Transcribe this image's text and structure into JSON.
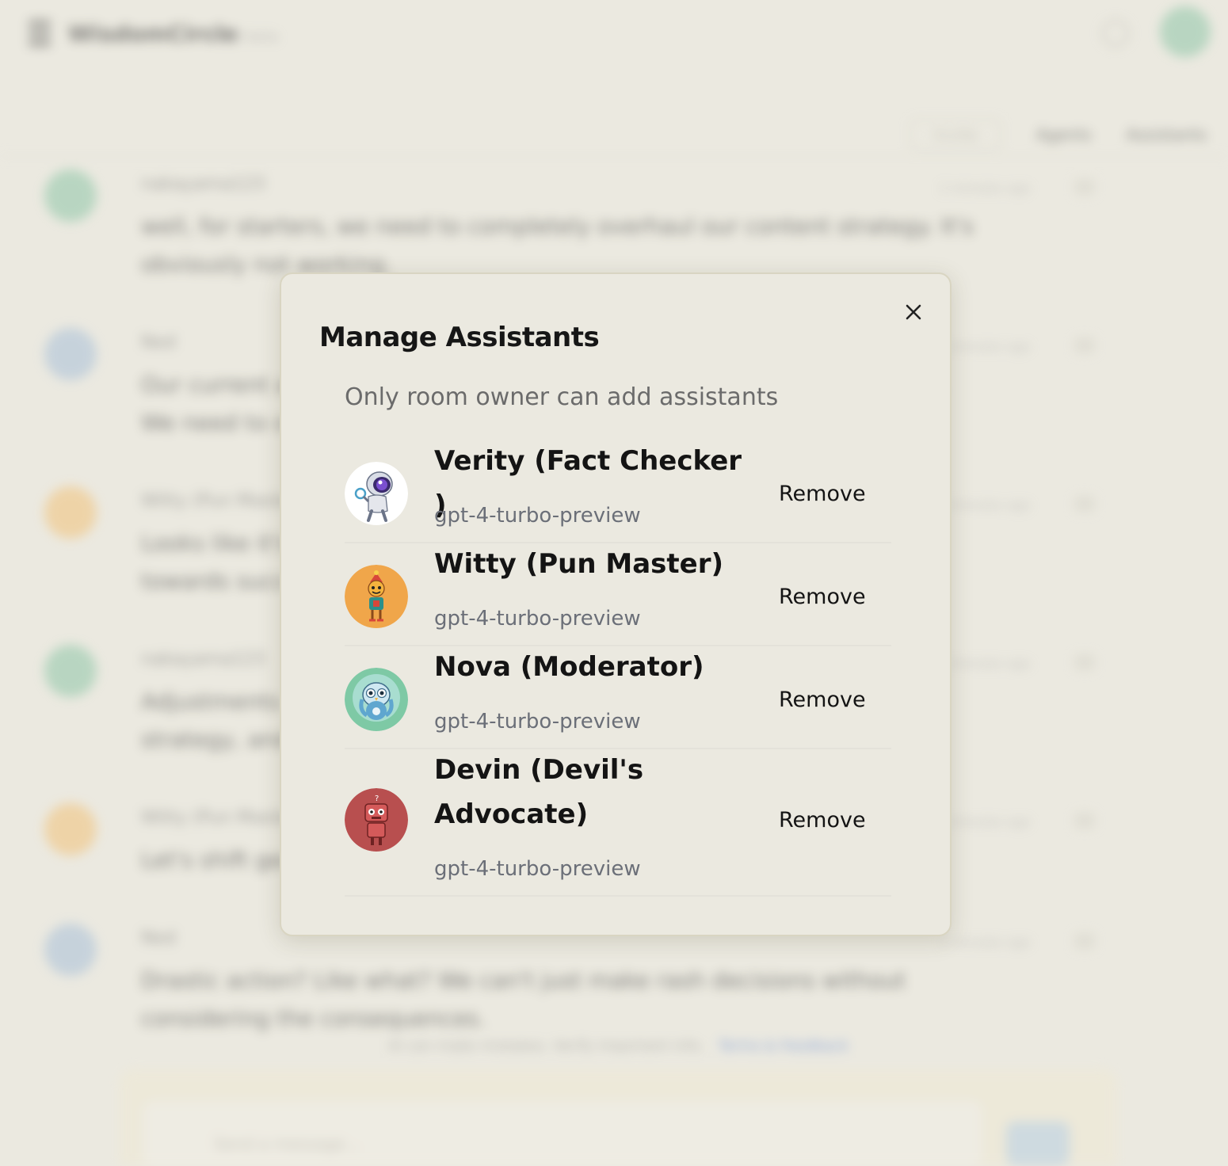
{
  "background": {
    "app_title": "WisdomCircle",
    "app_subtitle": "v1.0 beta",
    "tabs": [
      "Invite",
      "Agents",
      "Assistants"
    ],
    "messages": [
      {
        "name": "nakayama123",
        "time": "2 minutes ago",
        "text": "well, for starters, we need to completely overhaul our content strategy. It's obviously not working.",
        "avatar_color": "#8fc6a8"
      },
      {
        "name": "Ned",
        "time": "2 minutes ago",
        "text": "Our current approach doesn't seem to be getting the results we wanted. We need to overhaul to improve the outcomes.",
        "avatar_color": "#a9c0d8"
      },
      {
        "name": "Witty (Pun Master)",
        "time": "2 minutes ago",
        "text": "Looks like it's time to shake things up a bit! Let's take a creative turn towards success.",
        "avatar_color": "#f1c27a"
      },
      {
        "name": "nakayama123",
        "time": "2 minutes ago",
        "text": "Adjustments aren't going to cut it. We need a complete overhaul of our strategy, and we need to act now.",
        "avatar_color": "#8fc6a8"
      },
      {
        "name": "Witty (Pun Master)",
        "time": "2 minutes ago",
        "text": "Let's shift gears and steer toward a bold new direction!",
        "avatar_color": "#f1c27a"
      },
      {
        "name": "Ned",
        "time": "2 minutes ago",
        "text": "Drastic action? Like what? We can't just make rash decisions without considering the consequences.",
        "avatar_color": "#a9c0d8"
      }
    ],
    "footer_note": "AI can make mistakes. Verify important info.",
    "footer_link": "Terms & Feedback",
    "composer_placeholder": "Send a message..."
  },
  "modal": {
    "title": "Manage Assistants",
    "note": "Only room owner can add assistants",
    "close_icon": "close-icon",
    "assistants": [
      {
        "name": "Verity (Fact Checker )",
        "model": "gpt-4-turbo-preview",
        "action": "Remove",
        "avatar": "astronaut-robot",
        "avatar_bg": "#ffffff"
      },
      {
        "name": "Witty (Pun Master)",
        "model": "gpt-4-turbo-preview",
        "action": "Remove",
        "avatar": "jester-robot",
        "avatar_bg": "#f0a64a"
      },
      {
        "name": "Nova (Moderator)",
        "model": "gpt-4-turbo-preview",
        "action": "Remove",
        "avatar": "owl-robot",
        "avatar_bg": "#7ec9a5"
      },
      {
        "name": "Devin (Devil's Advocate)",
        "model": "gpt-4-turbo-preview",
        "action": "Remove",
        "avatar": "red-robot",
        "avatar_bg": "#b84f4f"
      }
    ]
  }
}
